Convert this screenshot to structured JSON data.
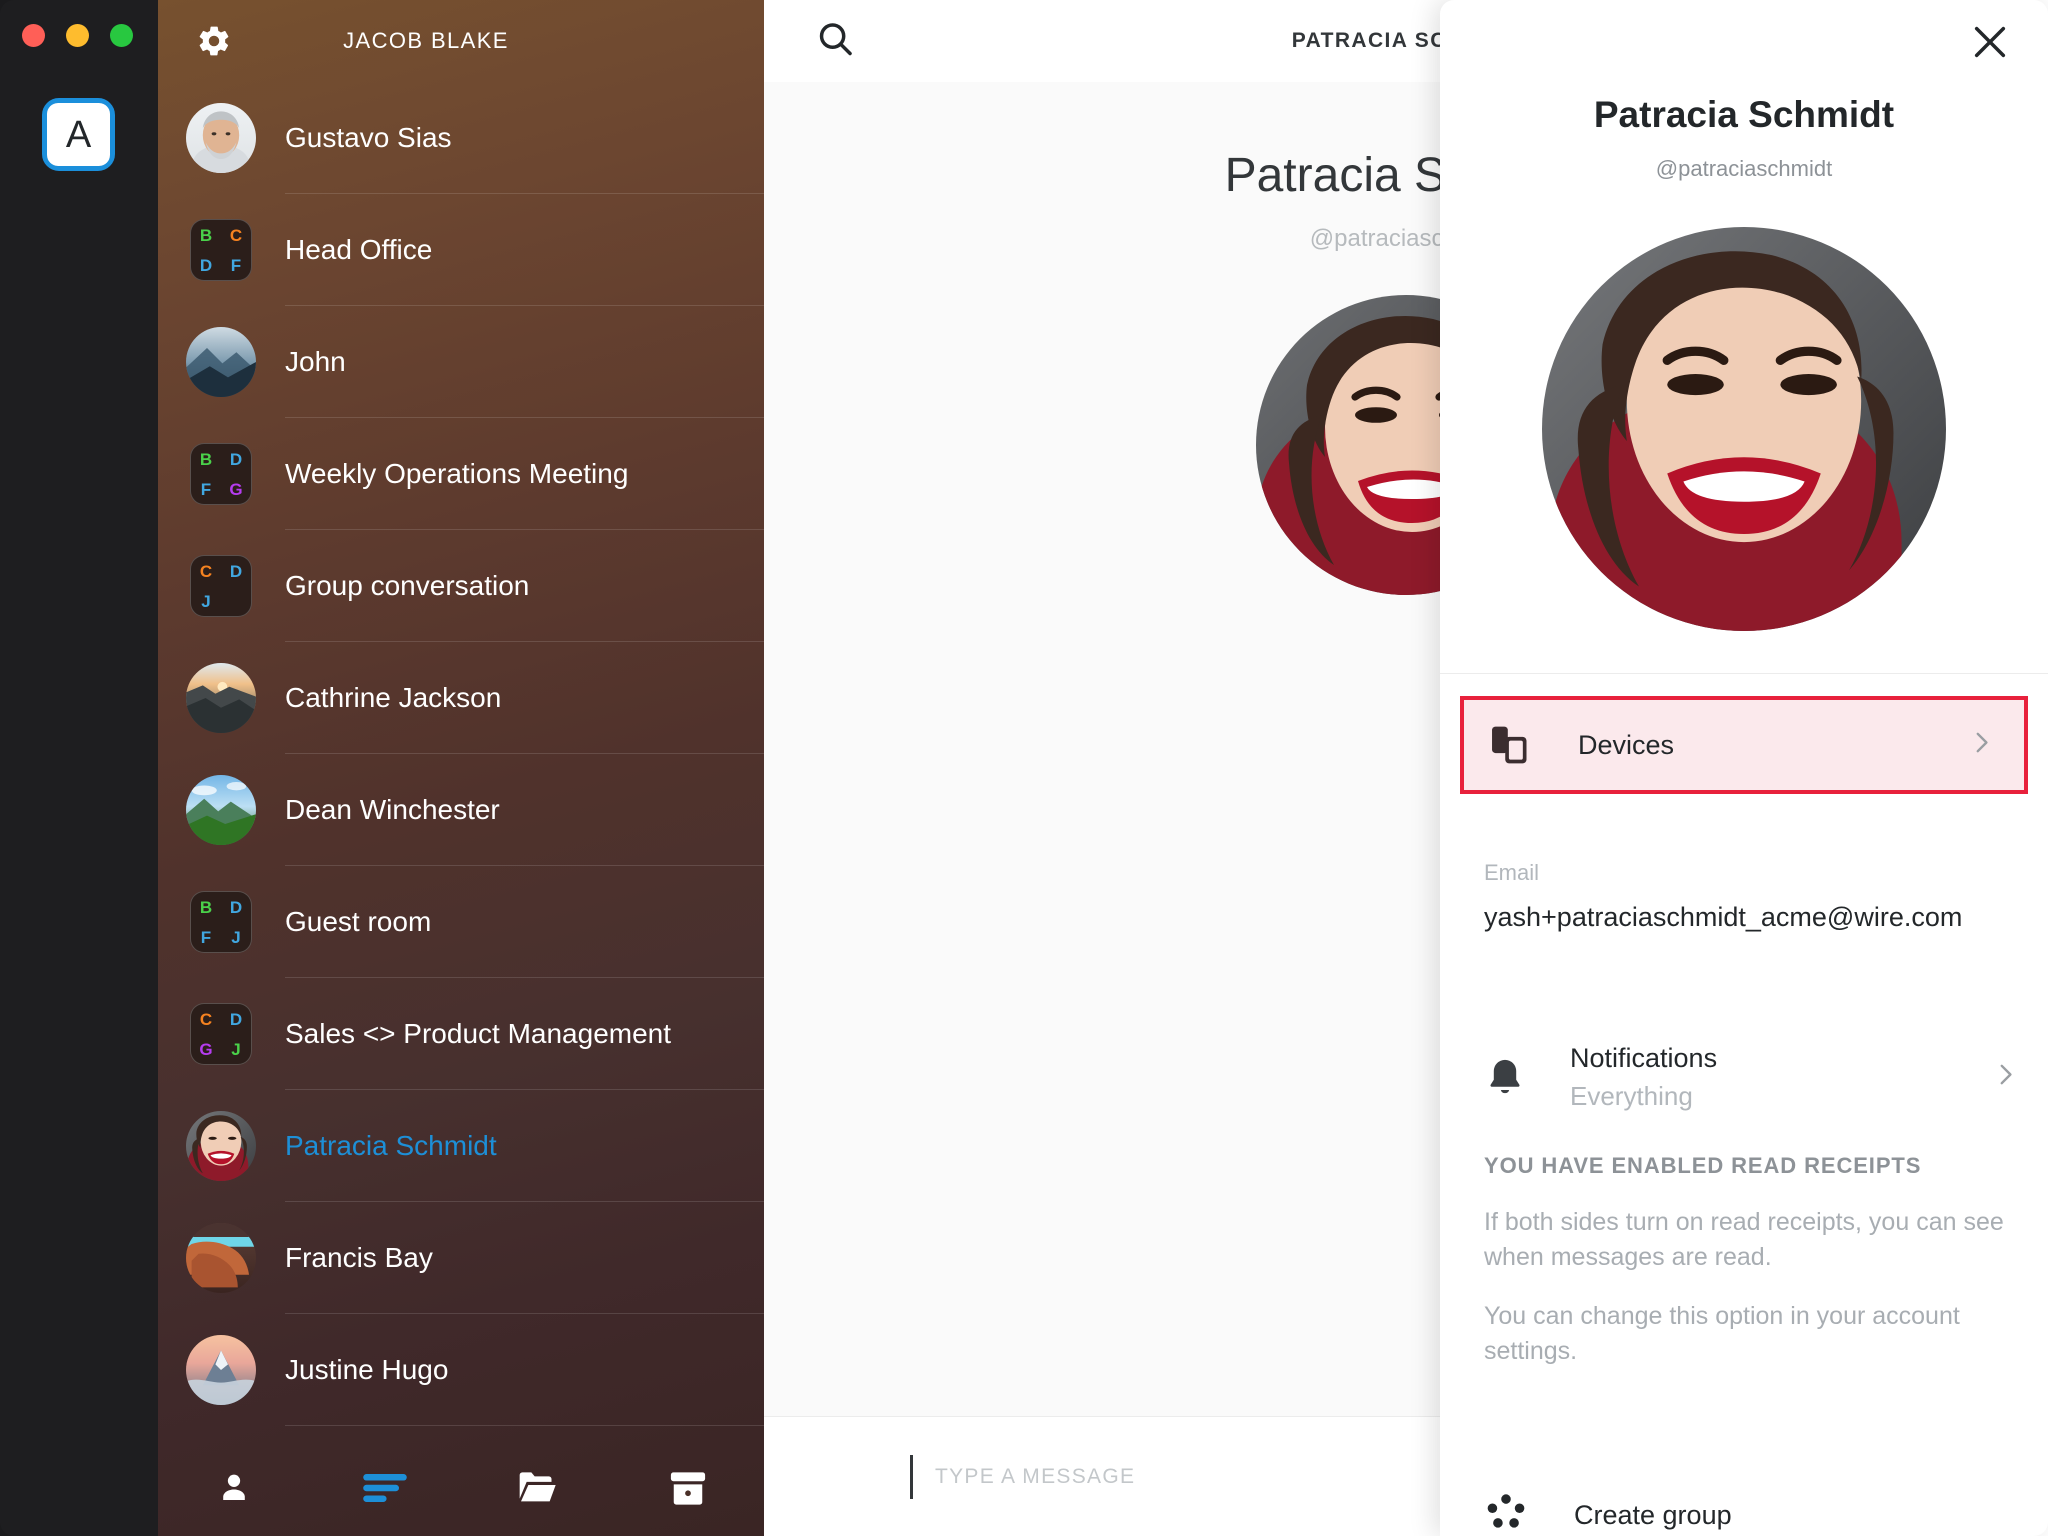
{
  "window": {
    "traffic_lights": [
      "close",
      "minimize",
      "maximize"
    ],
    "colors": {
      "close": "#ff5f57",
      "minimize": "#febc2e",
      "maximize": "#28c840"
    }
  },
  "rail": {
    "account_badge_letter": "A",
    "account_badge_ring_color": "#1b8fdb"
  },
  "sidebar": {
    "title": "JACOB BLAKE",
    "settings_icon": "gear-icon",
    "accent_color": "#1d8fd7",
    "items": [
      {
        "name": "Gustavo Sias",
        "avatar_type": "photo",
        "photo": "man-grey-beard",
        "selected": false
      },
      {
        "name": "Head Office",
        "avatar_type": "group",
        "letters": [
          "B",
          "C",
          "D",
          "F"
        ],
        "letter_colors": [
          "#4ad14a",
          "#f58220",
          "#41a7e0",
          "#41a7e0"
        ],
        "selected": false
      },
      {
        "name": "John",
        "avatar_type": "photo",
        "photo": "mountain-blue",
        "selected": false
      },
      {
        "name": "Weekly Operations Meeting",
        "avatar_type": "group",
        "letters": [
          "B",
          "D",
          "F",
          "G"
        ],
        "letter_colors": [
          "#4ad14a",
          "#41a7e0",
          "#41a7e0",
          "#b63cf0"
        ],
        "selected": false
      },
      {
        "name": "Group conversation",
        "avatar_type": "group",
        "letters": [
          "C",
          "D",
          "J",
          ""
        ],
        "letter_colors": [
          "#f58220",
          "#41a7e0",
          "#41a7e0",
          ""
        ],
        "selected": false
      },
      {
        "name": "Cathrine Jackson",
        "avatar_type": "photo",
        "photo": "canyon-sunrise",
        "selected": false
      },
      {
        "name": "Dean Winchester",
        "avatar_type": "photo",
        "photo": "green-valley",
        "selected": false
      },
      {
        "name": "Guest room",
        "avatar_type": "group",
        "letters": [
          "B",
          "D",
          "F",
          "J"
        ],
        "letter_colors": [
          "#4ad14a",
          "#41a7e0",
          "#41a7e0",
          "#41a7e0"
        ],
        "selected": false
      },
      {
        "name": "Sales <> Product Management",
        "avatar_type": "group",
        "letters": [
          "C",
          "D",
          "G",
          "J"
        ],
        "letter_colors": [
          "#f58220",
          "#41a7e0",
          "#b63cf0",
          "#4ad14a"
        ],
        "selected": false
      },
      {
        "name": "Patracia Schmidt",
        "avatar_type": "photo",
        "photo": "woman-smiling",
        "selected": true
      },
      {
        "name": "Francis Bay",
        "avatar_type": "photo",
        "photo": "desert-rock",
        "selected": false
      },
      {
        "name": "Justine Hugo",
        "avatar_type": "photo",
        "photo": "peak-sunset",
        "selected": false
      }
    ],
    "tabs": [
      {
        "icon": "person-icon",
        "active": false
      },
      {
        "icon": "conversations-icon",
        "active": true
      },
      {
        "icon": "folder-icon",
        "active": false
      },
      {
        "icon": "archive-icon",
        "active": false
      }
    ]
  },
  "center": {
    "search_icon": "search-icon",
    "header_title": "PATRACIA SCHMIDT",
    "name": "Patracia Schmidt",
    "handle": "@patraciaschmidt",
    "message_placeholder": "TYPE A MESSAGE"
  },
  "details": {
    "close_icon": "close-icon",
    "name": "Patracia Schmidt",
    "handle": "@patraciaschmidt",
    "devices": {
      "label": "Devices",
      "icon": "devices-icon",
      "chevron": "chevron-right-icon",
      "highlight_border_color": "#e8213c",
      "highlight_background_color": "#fbe9ec"
    },
    "email": {
      "label": "Email",
      "value": "yash+patraciaschmidt_acme@wire.com"
    },
    "notifications": {
      "icon": "bell-icon",
      "title": "Notifications",
      "value": "Everything",
      "chevron": "chevron-right-icon"
    },
    "read_receipts": {
      "heading": "YOU HAVE ENABLED READ RECEIPTS",
      "paragraph_1": "If both sides turn on read receipts, you can see when messages are read.",
      "paragraph_2": "You can change this option in your account settings."
    },
    "create_group": {
      "icon": "group-icon",
      "label": "Create group"
    }
  }
}
